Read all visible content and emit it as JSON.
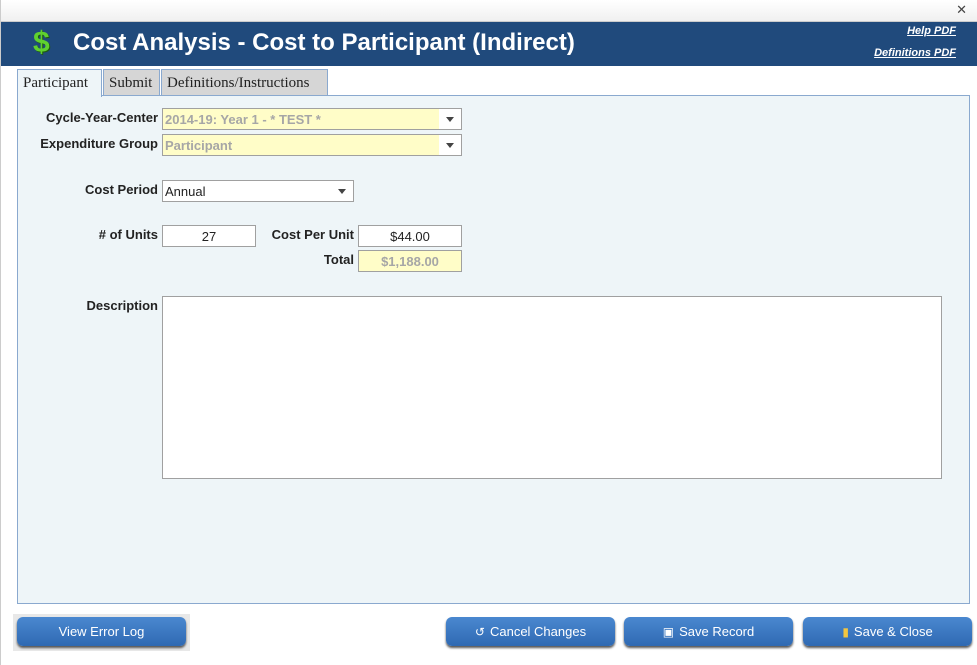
{
  "window": {
    "close_label": "✕"
  },
  "header": {
    "title": "Cost Analysis - Cost to Participant (Indirect)",
    "icon": "dollar-icon",
    "help_link": "Help PDF",
    "definitions_link": "Definitions PDF"
  },
  "tabs": [
    {
      "label": "Participant",
      "active": true
    },
    {
      "label": "Submit"
    },
    {
      "label": "Definitions/Instructions"
    }
  ],
  "form": {
    "cycle_label": "Cycle-Year-Center",
    "cycle_value": "2014-19: Year 1 - * TEST *",
    "group_label": "Expenditure Group",
    "group_value": "Participant",
    "period_label": "Cost Period",
    "period_value": "Annual",
    "units_label": "# of Units",
    "units_value": "27",
    "cpu_label": "Cost Per Unit",
    "cpu_value": "$44.00",
    "total_label": "Total",
    "total_value": "$1,188.00",
    "desc_label": "Description",
    "desc_value": ""
  },
  "buttons": {
    "error_log": "View Error Log",
    "cancel": "Cancel Changes",
    "save": "Save Record",
    "save_close": "Save & Close"
  }
}
